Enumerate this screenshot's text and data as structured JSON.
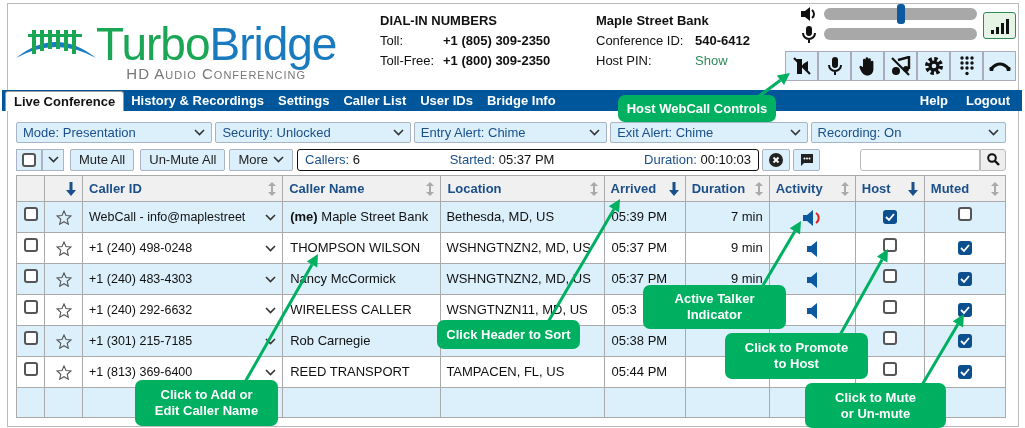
{
  "logo": {
    "word_1": "Turbo",
    "word_2": "Bridge",
    "tagline": "HD Audio Conferencing"
  },
  "dial_in": {
    "title": "DIAL-IN NUMBERS",
    "rows": [
      {
        "label": "Toll:",
        "value": "+1 (805) 309-2350"
      },
      {
        "label": "Toll-Free:",
        "value": "+1 (800) 309-2350"
      }
    ]
  },
  "conference": {
    "name": "Maple Street Bank",
    "rows": [
      {
        "label": "Conference ID:",
        "value": "540-6412",
        "kind": "text"
      },
      {
        "label": "Host PIN:",
        "value": "Show",
        "kind": "link"
      }
    ]
  },
  "speaker_volume": {
    "level": 0.5
  },
  "tabs": [
    {
      "label": "Live Conference",
      "selected": true
    },
    {
      "label": "History & Recordings",
      "selected": false
    },
    {
      "label": "Settings",
      "selected": false
    },
    {
      "label": "Caller List",
      "selected": false
    },
    {
      "label": "User IDs",
      "selected": false
    },
    {
      "label": "Bridge Info",
      "selected": false
    }
  ],
  "nav_links": [
    "Help",
    "Logout"
  ],
  "filters": [
    {
      "label": "Mode:",
      "value": "Presentation"
    },
    {
      "label": "Security:",
      "value": "Unlocked"
    },
    {
      "label": "Entry Alert:",
      "value": "Chime"
    },
    {
      "label": "Exit Alert:",
      "value": "Chime"
    },
    {
      "label": "Recording:",
      "value": "On"
    }
  ],
  "toolbar": {
    "select_all_checked": false,
    "buttons": [
      "Mute All",
      "Un-Mute All"
    ],
    "more": "More",
    "status": [
      {
        "label": "Callers:",
        "value": "6"
      },
      {
        "label": "Started:",
        "value": "05:37 PM"
      },
      {
        "label": "Duration:",
        "value": "00:10:03"
      }
    ]
  },
  "table": {
    "columns": [
      {
        "kind": "blank"
      },
      {
        "kind": "icon",
        "sorted": true
      },
      {
        "kind": "label",
        "label": "Caller ID",
        "sorted": false
      },
      {
        "kind": "label",
        "label": "Caller Name",
        "sorted": false
      },
      {
        "kind": "label",
        "label": "Location",
        "sorted": false
      },
      {
        "kind": "label",
        "label": "Arrived",
        "sorted": true
      },
      {
        "kind": "label",
        "label": "Duration",
        "sorted": false
      },
      {
        "kind": "label",
        "label": "Activity",
        "sorted": false
      },
      {
        "kind": "label",
        "label": "Host",
        "sorted": true
      },
      {
        "kind": "label",
        "label": "Muted",
        "sorted": false
      }
    ],
    "rows": [
      {
        "checked": false,
        "starred": false,
        "caller_id": "WebCall - info@maplestreet",
        "name": "**(me)** Maple Street Bank",
        "location": "Bethesda, MD, US",
        "arrived": "05:39 PM",
        "duration": "7 min",
        "active_talker": true,
        "host": true,
        "muted": false
      },
      {
        "checked": false,
        "starred": false,
        "caller_id": "+1 (240) 498-0248",
        "name": "THOMPSON WILSON",
        "location": "WSHNGTNZN2, MD, US",
        "arrived": "05:37 PM",
        "duration": "9 min",
        "active_talker": false,
        "host": false,
        "muted": true
      },
      {
        "checked": false,
        "starred": false,
        "caller_id": "+1 (240) 483-4303",
        "name": "Nancy McCormick",
        "location": "WSHNGTNZN2, MD, US",
        "arrived": "05:37 PM",
        "duration": "9 min",
        "active_talker": false,
        "host": false,
        "muted": true
      },
      {
        "checked": false,
        "starred": false,
        "caller_id": "+1 (240) 292-6632",
        "name": "WIRELESS CALLER",
        "location": "WSNGTNZN11, MD, US",
        "arrived": "05:3",
        "active_talker": false,
        "host": false,
        "muted": true
      },
      {
        "checked": false,
        "starred": false,
        "caller_id": "+1 (301) 215-7185",
        "name": "Rob Carnegie",
        "arrived": "05:38 PM",
        "host": false,
        "muted": true
      },
      {
        "checked": false,
        "starred": false,
        "caller_id": "+1 (813) 369-6400",
        "name": "REED TRANSPORT",
        "location": "TAMPACEN, FL, US",
        "arrived": "05:44 PM",
        "host": false,
        "muted": true
      }
    ]
  },
  "callouts": [
    "Host WebCall Controls",
    "Active Talker Indicator",
    "Click Header to Sort",
    "Click to Promote to Host",
    "Click to Add or Edit Caller Name",
    "Click to Mute or Un-mute"
  ]
}
